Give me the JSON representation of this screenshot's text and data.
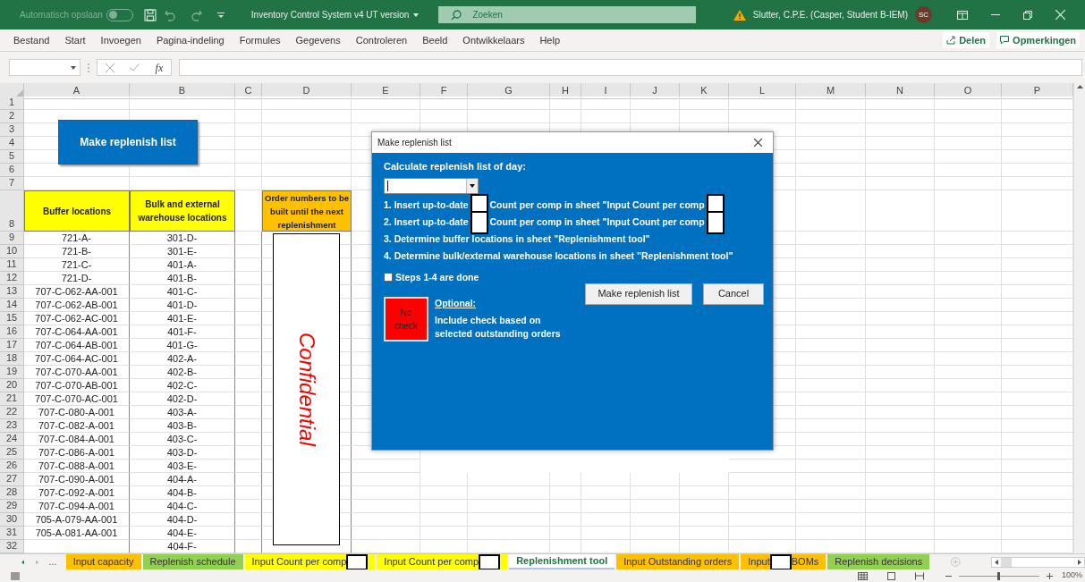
{
  "title_bar": {
    "autosave_label": "Automatisch opslaan",
    "autosave_on": false,
    "document_title": "Inventory Control System v4 UT version",
    "search_placeholder": "Zoeken",
    "user_name": "Slutter, C.P.E. (Casper, Student B-IEM)",
    "avatar_initials": "SC"
  },
  "ribbon_tabs": [
    "Bestand",
    "Start",
    "Invoegen",
    "Pagina-indeling",
    "Formules",
    "Gegevens",
    "Controleren",
    "Beeld",
    "Ontwikkelaars",
    "Help"
  ],
  "share_button": "Delen",
  "comments_button": "Opmerkingen",
  "formula_bar": {
    "fx_label": "fx"
  },
  "columns": [
    "A",
    "B",
    "C",
    "D",
    "E",
    "F",
    "G",
    "H",
    "I",
    "J",
    "K",
    "L",
    "M",
    "N",
    "O",
    "P"
  ],
  "header_row": {
    "number": "8",
    "buffer": "Buffer locations",
    "bulk": "Bulk and external warehouse locations",
    "orders": "Order numbers to be built until the next replenishment"
  },
  "top_rows": [
    "1",
    "2",
    "3",
    "4",
    "5",
    "6",
    "7"
  ],
  "rows": [
    {
      "number": "9",
      "a": "721-A-",
      "b": "301-D-"
    },
    {
      "number": "10",
      "a": "721-B-",
      "b": "301-E-"
    },
    {
      "number": "11",
      "a": "721-C-",
      "b": "401-A-"
    },
    {
      "number": "12",
      "a": "721-D-",
      "b": "401-B-"
    },
    {
      "number": "13",
      "a": "707-C-062-AA-001",
      "b": "401-C-"
    },
    {
      "number": "14",
      "a": "707-C-062-AB-001",
      "b": "401-D-"
    },
    {
      "number": "15",
      "a": "707-C-062-AC-001",
      "b": "401-E-"
    },
    {
      "number": "16",
      "a": "707-C-064-AA-001",
      "b": "401-F-"
    },
    {
      "number": "17",
      "a": "707-C-064-AB-001",
      "b": "401-G-"
    },
    {
      "number": "18",
      "a": "707-C-064-AC-001",
      "b": "402-A-"
    },
    {
      "number": "19",
      "a": "707-C-070-AA-001",
      "b": "402-B-"
    },
    {
      "number": "20",
      "a": "707-C-070-AB-001",
      "b": "402-C-"
    },
    {
      "number": "21",
      "a": "707-C-070-AC-001",
      "b": "402-D-"
    },
    {
      "number": "22",
      "a": "707-C-080-A-001",
      "b": "403-A-"
    },
    {
      "number": "23",
      "a": "707-C-082-A-001",
      "b": "403-B-"
    },
    {
      "number": "24",
      "a": "707-C-084-A-001",
      "b": "403-C-"
    },
    {
      "number": "25",
      "a": "707-C-086-A-001",
      "b": "403-D-"
    },
    {
      "number": "26",
      "a": "707-C-088-A-001",
      "b": "403-E-"
    },
    {
      "number": "27",
      "a": "707-C-090-A-001",
      "b": "404-A-"
    },
    {
      "number": "28",
      "a": "707-C-092-A-001",
      "b": "404-B-"
    },
    {
      "number": "29",
      "a": "707-C-094-A-001",
      "b": "404-C-"
    },
    {
      "number": "30",
      "a": "705-A-079-AA-001",
      "b": "404-D-"
    },
    {
      "number": "31",
      "a": "705-A-081-AA-001",
      "b": "404-E-"
    },
    {
      "number": "32",
      "b": "404-F-"
    }
  ],
  "sheet_button": "Make replenish list",
  "confidential_label": "Confidential",
  "dialog": {
    "title": "Make replenish list",
    "prompt": "Calculate replenish list of day:",
    "steps": [
      {
        "parts": [
          {
            "kind": "text",
            "text": "1. Insert up-to-date"
          },
          {
            "kind": "redaction"
          },
          {
            "kind": "text",
            "text": "Count per comp in sheet \"Input Count per comp"
          },
          {
            "kind": "redaction"
          }
        ]
      },
      {
        "parts": [
          {
            "kind": "text",
            "text": "2. Insert up-to-date"
          },
          {
            "kind": "redaction"
          },
          {
            "kind": "text",
            "text": "Count per comp in sheet \"Input Count per comp"
          },
          {
            "kind": "redaction"
          }
        ]
      },
      {
        "parts": [
          {
            "kind": "text",
            "text": "3. Determine buffer locations in sheet \"Replenishment tool\""
          }
        ]
      },
      {
        "parts": [
          {
            "kind": "text",
            "text": "4. Determine bulk/external warehouse locations in sheet \"Replenishment tool\""
          }
        ]
      }
    ],
    "steps_done": {
      "label": "Steps 1-4 are done",
      "checked": false
    },
    "make_button": "Make replenish list",
    "cancel_button": "Cancel",
    "check_toggle": {
      "label": "No check",
      "on": false
    },
    "optional_title": "Optional:",
    "optional_text": "Include check based on selected outstanding orders"
  },
  "sheet_nav_more": "...",
  "sheet_tabs": [
    {
      "parts": [
        {
          "kind": "text",
          "text": "Input capacity"
        }
      ],
      "color": "#ffc000",
      "selected": false
    },
    {
      "parts": [
        {
          "kind": "text",
          "text": "Replenish schedule"
        }
      ],
      "color": "#92d050",
      "selected": false
    },
    {
      "parts": [
        {
          "kind": "text",
          "text": "Input Count per comp"
        },
        {
          "kind": "redaction"
        }
      ],
      "color": "#ffff00",
      "selected": false
    },
    {
      "parts": [
        {
          "kind": "text",
          "text": "Input Count per comp"
        },
        {
          "kind": "redaction"
        }
      ],
      "color": "#ffff00",
      "selected": false
    },
    {
      "parts": [
        {
          "kind": "text",
          "text": "Replenishment tool"
        }
      ],
      "color": "#b4c6e7",
      "selected": true
    },
    {
      "parts": [
        {
          "kind": "text",
          "text": "Input Outstanding orders"
        }
      ],
      "color": "#ffc000",
      "selected": false
    },
    {
      "parts": [
        {
          "kind": "text",
          "text": "Input"
        },
        {
          "kind": "redaction"
        },
        {
          "kind": "text",
          "text": "BOMs"
        }
      ],
      "color": "#ffc000",
      "selected": false
    },
    {
      "parts": [
        {
          "kind": "text",
          "text": "Replenish decisions"
        }
      ],
      "color": "#92d050",
      "selected": false
    }
  ],
  "status_bar": {
    "zoom": "100%",
    "zoom_slider": {
      "level": 0.5
    }
  }
}
